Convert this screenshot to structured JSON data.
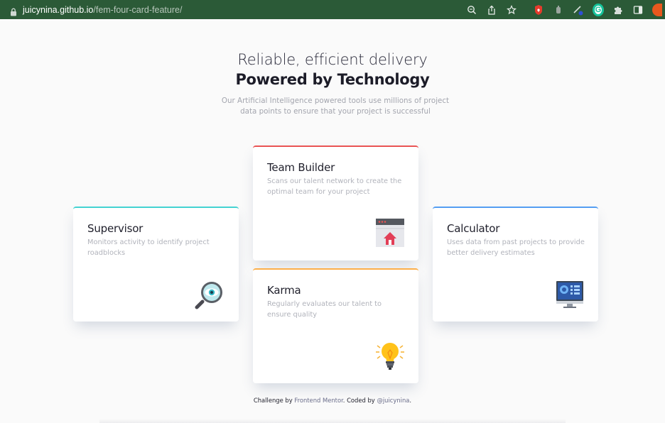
{
  "browser": {
    "url_host": "juicynina.github.io",
    "url_path": "/fem-four-card-feature/",
    "extension_letter": "G",
    "icons": [
      "lock-icon",
      "zoom-icon",
      "share-icon",
      "bookmark-star-icon",
      "extension-red-icon",
      "extension-gray-icon",
      "extension-pen-icon",
      "grammarly-icon",
      "puzzle-icon",
      "side-panel-icon",
      "profile-avatar"
    ]
  },
  "hero": {
    "title_light": "Reliable, efficient delivery",
    "title_bold": "Powered by Technology",
    "description": "Our Artificial Intelligence powered tools use millions of project data points to ensure that your project is successful"
  },
  "cards": {
    "supervisor": {
      "title": "Supervisor",
      "description": "Monitors activity to identify project roadblocks",
      "accent": "#44d3d2",
      "icon": "magnifier-eye-icon"
    },
    "team_builder": {
      "title": "Team Builder",
      "description": "Scans our talent network to create the optimal team for your project",
      "accent": "#ea5454",
      "icon": "browser-home-icon"
    },
    "karma": {
      "title": "Karma",
      "description": "Regularly evaluates our talent to ensure quality",
      "accent": "#fcaf4a",
      "icon": "lightbulb-icon"
    },
    "calculator": {
      "title": "Calculator",
      "description": "Uses data from past projects to provide better delivery estimates",
      "accent": "#549ef2",
      "icon": "monitor-dashboard-icon"
    }
  },
  "footer": {
    "prefix": "Challenge by ",
    "link1": "Frontend Mentor",
    "middle": ". Coded by ",
    "link2": "@juicynina",
    "suffix": "."
  }
}
